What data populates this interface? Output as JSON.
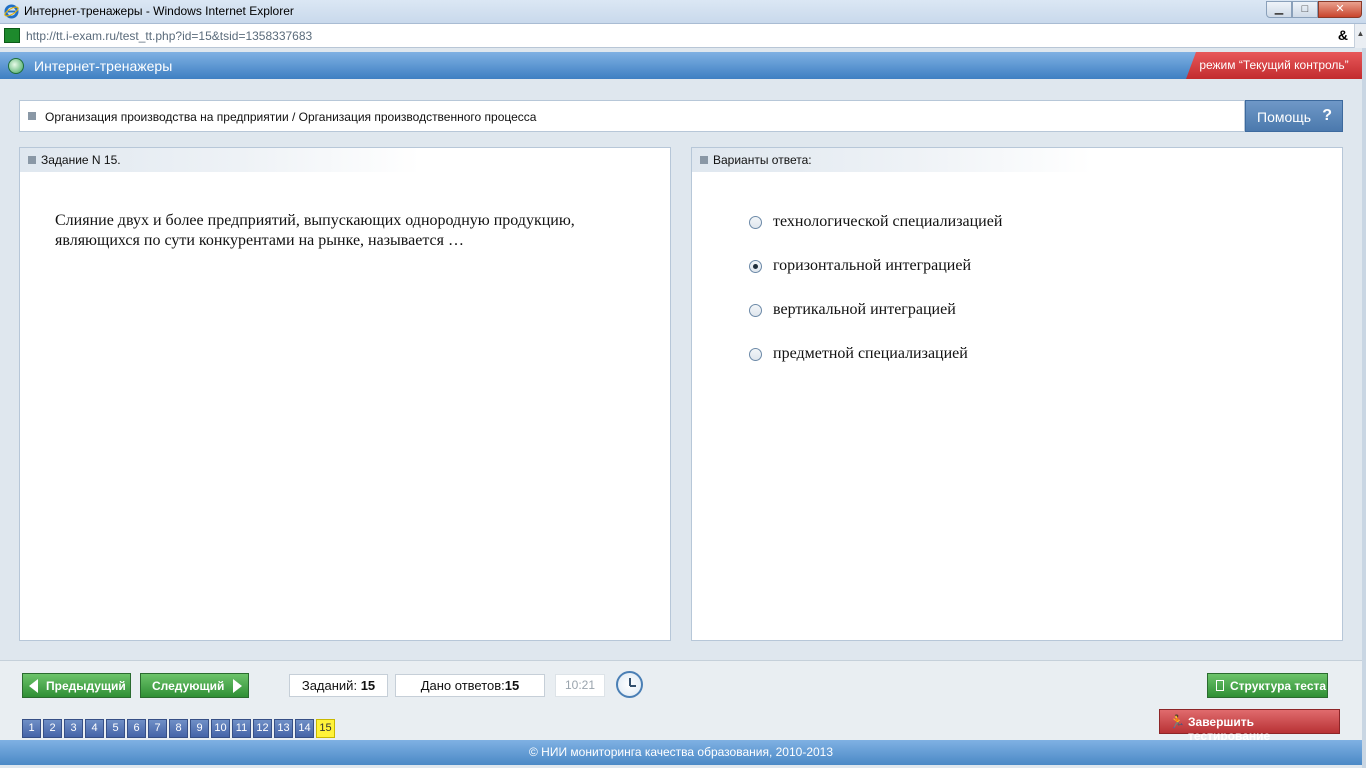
{
  "window": {
    "title": "Интернет-тренажеры - Windows Internet Explorer",
    "min_label": "▁",
    "max_label": "□",
    "close_label": "✕"
  },
  "address_bar": {
    "url": "http://tt.i-exam.ru/test_tt.php?id=15&tsid=1358337683",
    "tools_label": "&",
    "scroll_label": "▲"
  },
  "app": {
    "title": "Интернет-тренажеры",
    "mode": "режим “Текущий контроль”"
  },
  "breadcrumb": {
    "text": "Организация производства на предприятии / Организация производственного процесса"
  },
  "help": {
    "label": "Помощь",
    "icon_glyph": "?"
  },
  "task": {
    "heading": "Задание N 15.",
    "question": "Слияние двух и более предприятий, выпускающих однородную продукцию, являющихся по сути конкурентами на рынке, называется …"
  },
  "answers": {
    "heading": "Варианты ответа:",
    "options": [
      {
        "label": "технологической специализацией",
        "selected": false
      },
      {
        "label": "горизонтальной интеграцией",
        "selected": true
      },
      {
        "label": "вертикальной интеграцией",
        "selected": false
      },
      {
        "label": "предметной специализацией",
        "selected": false
      }
    ]
  },
  "toolbar": {
    "prev_label": "Предыдущий",
    "next_label": "Следующий",
    "tasks_label": "Заданий:",
    "tasks_count": "15",
    "answered_label": "Дано ответов:",
    "answered_count": "15",
    "timer": "10:21",
    "structure_label": "Структура теста",
    "finish_label": "Завершить тестирование",
    "finish_icon_glyph": "🏃",
    "pages": [
      "1",
      "2",
      "3",
      "4",
      "5",
      "6",
      "7",
      "8",
      "9",
      "10",
      "11",
      "12",
      "13",
      "14",
      "15"
    ],
    "current_page": "15"
  },
  "footer": {
    "text": "© НИИ мониторинга качества образования, 2010-2013"
  },
  "colors": {
    "header_blue": "#3e7fc2",
    "mode_red": "#c22b2e",
    "green_button": "#2f8f35",
    "active_page": "#fff23a"
  }
}
